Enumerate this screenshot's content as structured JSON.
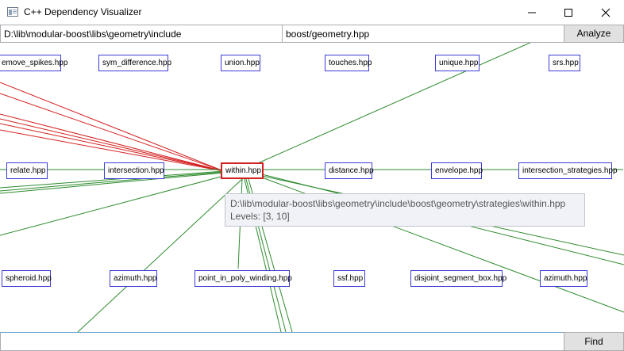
{
  "window": {
    "title": "C++ Dependency Visualizer"
  },
  "toolbar": {
    "path_value": "D:\\lib\\modular-boost\\libs\\geometry\\include",
    "file_value": "boost/geometry.hpp",
    "analyze_label": "Analyze"
  },
  "graph": {
    "selected": "within.hpp",
    "nodes": [
      "emove_spikes.hpp",
      "sym_difference.hpp",
      "union.hpp",
      "touches.hpp",
      "unique.hpp",
      "srs.hpp",
      "relate.hpp",
      "intersection.hpp",
      "within.hpp",
      "distance.hpp",
      "envelope.hpp",
      "intersection_strategies.hpp",
      "spheroid.hpp",
      "azimuth.hpp",
      "point_in_poly_winding.hpp",
      "ssf.hpp",
      "disjoint_segment_box.hpp",
      "azimuth.hpp"
    ],
    "colors": {
      "node_border": "#3b3bd6",
      "selected_border": "#d42020",
      "include_edge": "#d42020",
      "dependent_edge": "#2e8b2e"
    }
  },
  "tooltip": {
    "path": "D:\\lib\\modular-boost\\libs\\geometry\\include\\boost\\geometry\\strategies\\within.hpp",
    "levels": "Levels: [3, 10]"
  },
  "find": {
    "value": "",
    "button_label": "Find"
  }
}
